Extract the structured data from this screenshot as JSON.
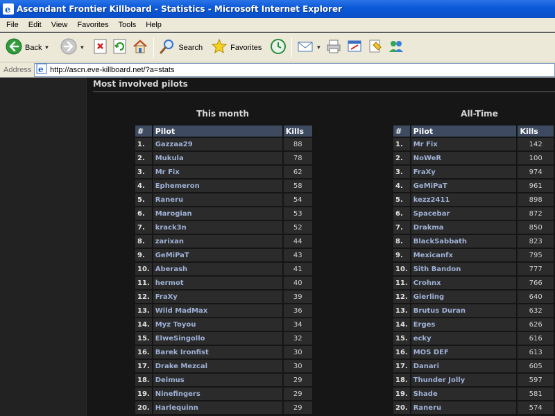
{
  "window": {
    "title": "Ascendant Frontier Killboard - Statistics - Microsoft Internet Explorer"
  },
  "menu": [
    "File",
    "Edit",
    "View",
    "Favorites",
    "Tools",
    "Help"
  ],
  "toolbar": {
    "back_label": "Back",
    "search_label": "Search",
    "favorites_label": "Favorites"
  },
  "address": {
    "label": "Address",
    "url": "http://ascn.eve-killboard.net/?a=stats"
  },
  "page": {
    "section_title": "Most involved pilots",
    "month_heading": "This month",
    "alltime_heading": "All-Time",
    "columns": {
      "num": "#",
      "pilot": "Pilot",
      "kills": "Kills"
    },
    "this_month": [
      {
        "num": "1.",
        "pilot": "Gazzaa29",
        "kills": "88"
      },
      {
        "num": "2.",
        "pilot": "Mukula",
        "kills": "78"
      },
      {
        "num": "3.",
        "pilot": "Mr Fix",
        "kills": "62"
      },
      {
        "num": "4.",
        "pilot": "Ephemeron",
        "kills": "58"
      },
      {
        "num": "5.",
        "pilot": "Raneru",
        "kills": "54"
      },
      {
        "num": "6.",
        "pilot": "Marogian",
        "kills": "53"
      },
      {
        "num": "7.",
        "pilot": "krack3n",
        "kills": "52"
      },
      {
        "num": "8.",
        "pilot": "zarixan",
        "kills": "44"
      },
      {
        "num": "9.",
        "pilot": "GeMiPaT",
        "kills": "43"
      },
      {
        "num": "10.",
        "pilot": "Aberash",
        "kills": "41"
      },
      {
        "num": "11.",
        "pilot": "hermot",
        "kills": "40"
      },
      {
        "num": "12.",
        "pilot": "FraXy",
        "kills": "39"
      },
      {
        "num": "13.",
        "pilot": "Wild MadMax",
        "kills": "36"
      },
      {
        "num": "14.",
        "pilot": "Myz Toyou",
        "kills": "34"
      },
      {
        "num": "15.",
        "pilot": "ElweSingollo",
        "kills": "32"
      },
      {
        "num": "16.",
        "pilot": "Barek Ironfist",
        "kills": "30"
      },
      {
        "num": "17.",
        "pilot": "Drake Mezcal",
        "kills": "30"
      },
      {
        "num": "18.",
        "pilot": "Deimus",
        "kills": "29"
      },
      {
        "num": "19.",
        "pilot": "Ninefingers",
        "kills": "29"
      },
      {
        "num": "20.",
        "pilot": "Harlequinn",
        "kills": "29"
      }
    ],
    "all_time": [
      {
        "num": "1.",
        "pilot": "Mr Fix",
        "kills": "142"
      },
      {
        "num": "2.",
        "pilot": "NoWeR",
        "kills": "100"
      },
      {
        "num": "3.",
        "pilot": "FraXy",
        "kills": "974"
      },
      {
        "num": "4.",
        "pilot": "GeMiPaT",
        "kills": "961"
      },
      {
        "num": "5.",
        "pilot": "kezz2411",
        "kills": "898"
      },
      {
        "num": "6.",
        "pilot": "Spacebar",
        "kills": "872"
      },
      {
        "num": "7.",
        "pilot": "Drakma",
        "kills": "850"
      },
      {
        "num": "8.",
        "pilot": "BlackSabbath",
        "kills": "823"
      },
      {
        "num": "9.",
        "pilot": "Mexicanfx",
        "kills": "795"
      },
      {
        "num": "10.",
        "pilot": "Sith Bandon",
        "kills": "777"
      },
      {
        "num": "11.",
        "pilot": "Crohnx",
        "kills": "766"
      },
      {
        "num": "12.",
        "pilot": "Gierling",
        "kills": "640"
      },
      {
        "num": "13.",
        "pilot": "Brutus Duran",
        "kills": "632"
      },
      {
        "num": "14.",
        "pilot": "Erges",
        "kills": "626"
      },
      {
        "num": "15.",
        "pilot": "ecky",
        "kills": "616"
      },
      {
        "num": "16.",
        "pilot": "MOS DEF",
        "kills": "613"
      },
      {
        "num": "17.",
        "pilot": "Danari",
        "kills": "605"
      },
      {
        "num": "18.",
        "pilot": "Thunder Jolly",
        "kills": "597"
      },
      {
        "num": "19.",
        "pilot": "Shade",
        "kills": "581"
      },
      {
        "num": "20.",
        "pilot": "Raneru",
        "kills": "574"
      }
    ]
  }
}
